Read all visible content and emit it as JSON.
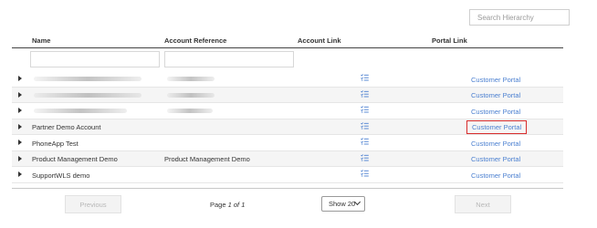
{
  "search": {
    "placeholder": "Search Hierarchy"
  },
  "table": {
    "columns": {
      "name": "Name",
      "account_reference": "Account Reference",
      "account_link": "Account Link",
      "portal_link": "Portal Link"
    },
    "rows": [
      {
        "name": "",
        "reference": "",
        "portal": "Customer Portal",
        "blurred": true
      },
      {
        "name": "",
        "reference": "",
        "portal": "Customer Portal",
        "blurred": true
      },
      {
        "name": "",
        "reference": "",
        "portal": "Customer Portal",
        "blurred": true
      },
      {
        "name": "Partner Demo Account",
        "reference": "",
        "portal": "Customer Portal",
        "blurred": false,
        "highlighted": true
      },
      {
        "name": "PhoneApp Test",
        "reference": "",
        "portal": "Customer Portal",
        "blurred": false
      },
      {
        "name": "Product Management Demo",
        "reference": "Product Management Demo",
        "portal": "Customer Portal",
        "blurred": false
      },
      {
        "name": "SupportWLS demo",
        "reference": "",
        "portal": "Customer Portal",
        "blurred": false
      }
    ]
  },
  "pagination": {
    "previous": "Previous",
    "page_prefix": "Page",
    "page_current": "1",
    "page_of": "of",
    "page_total": "1",
    "show": "Show 20",
    "next": "Next"
  },
  "icons": {
    "account_link": "list-check-icon",
    "expand": "caret-right-icon"
  },
  "colors": {
    "link": "#4a7fd0",
    "highlight": "#d82c2c"
  }
}
